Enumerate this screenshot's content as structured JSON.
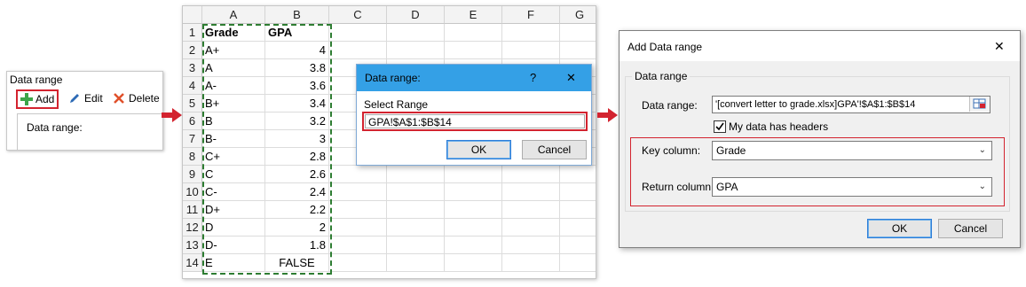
{
  "panel1": {
    "title": "Data range",
    "add_label": "Add",
    "edit_label": "Edit",
    "delete_label": "Delete",
    "list_text": "Data range:"
  },
  "sheet": {
    "columns": [
      "A",
      "B",
      "C",
      "D",
      "E",
      "F",
      "G"
    ],
    "rows": [
      {
        "n": "1",
        "a": "Grade",
        "b": "GPA"
      },
      {
        "n": "2",
        "a": "A+",
        "b": "4"
      },
      {
        "n": "3",
        "a": "A",
        "b": "3.8"
      },
      {
        "n": "4",
        "a": "A-",
        "b": "3.6"
      },
      {
        "n": "5",
        "a": "B+",
        "b": "3.4"
      },
      {
        "n": "6",
        "a": "B",
        "b": "3.2"
      },
      {
        "n": "7",
        "a": "B-",
        "b": "3"
      },
      {
        "n": "8",
        "a": "C+",
        "b": "2.8"
      },
      {
        "n": "9",
        "a": "C",
        "b": "2.6"
      },
      {
        "n": "10",
        "a": "C-",
        "b": "2.4"
      },
      {
        "n": "11",
        "a": "D+",
        "b": "2.2"
      },
      {
        "n": "12",
        "a": "D",
        "b": "2"
      },
      {
        "n": "13",
        "a": "D-",
        "b": "1.8"
      },
      {
        "n": "14",
        "a": "E",
        "b": "FALSE"
      }
    ]
  },
  "select_dialog": {
    "title": "Data range:",
    "help": "?",
    "close": "✕",
    "label": "Select Range",
    "value": "GPA!$A$1:$B$14",
    "ok": "OK",
    "cancel": "Cancel"
  },
  "add_dialog": {
    "title": "Add Data range",
    "close": "✕",
    "group_label": "Data range",
    "range_label": "Data range:",
    "range_value": "'[convert letter to grade.xlsx]GPA'!$A$1:$B$14",
    "headers_checkbox": "My data has headers",
    "key_label": "Key column:",
    "key_value": "Grade",
    "return_label": "Return column:",
    "return_value": "GPA",
    "ok": "OK",
    "cancel": "Cancel"
  },
  "colors": {
    "accent_red": "#d3232f",
    "titlebar_blue": "#34a0e6",
    "marquee_green": "#2e7d32"
  }
}
